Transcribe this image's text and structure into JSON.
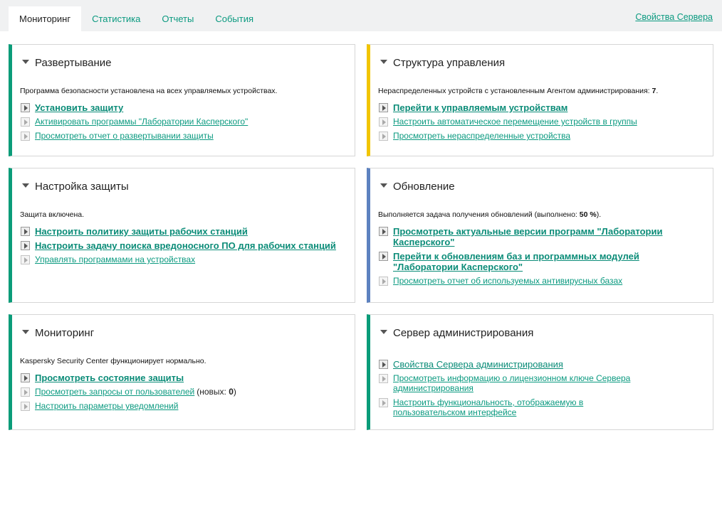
{
  "tabs": [
    {
      "label": "Мониторинг",
      "active": true
    },
    {
      "label": "Статистика",
      "active": false
    },
    {
      "label": "Отчеты",
      "active": false
    },
    {
      "label": "События",
      "active": false
    }
  ],
  "server_properties_link": "Свойства Сервера",
  "cards": {
    "deployment": {
      "title": "Развертывание",
      "desc": "Программа безопасности установлена на всех управляемых устройствах.",
      "links": [
        "Установить защиту",
        "Активировать программы \"Лаборатории Касперского\"",
        "Просмотреть отчет о развертывании защиты"
      ]
    },
    "structure": {
      "title": "Структура управления",
      "desc_prefix": "Нераспределенных устройств с установленным Агентом администрирования: ",
      "desc_value": "7",
      "desc_suffix": ".",
      "links": [
        "Перейти к управляемым устройствам",
        "Настроить автоматическое перемещение устройств в группы",
        "Просмотреть нераспределенные устройства"
      ]
    },
    "protection": {
      "title": "Настройка защиты",
      "desc": "Защита включена.",
      "links": [
        "Настроить политику защиты рабочих станций",
        "Настроить задачу поиска вредоносного ПО для рабочих станций",
        "Управлять программами на устройствах"
      ]
    },
    "update": {
      "title": "Обновление",
      "desc_prefix": "Выполняется задача получения обновлений (выполнено: ",
      "desc_value": "50 %",
      "desc_suffix": ").",
      "links": [
        "Просмотреть актуальные версии программ \"Лаборатории Касперского\"",
        "Перейти к обновлениям баз и программных модулей \"Лаборатории Касперского\"",
        "Просмотреть отчет об используемых антивирусных базах"
      ]
    },
    "monitoring": {
      "title": "Мониторинг",
      "desc": "Kaspersky Security Center функционирует нормально.",
      "links": [
        "Просмотреть состояние защиты",
        "Просмотреть запросы от пользователей",
        "Настроить параметры уведомлений"
      ],
      "requests_suffix_prefix": "(новых: ",
      "requests_suffix_value": "0",
      "requests_suffix_end": ")"
    },
    "admin_server": {
      "title": "Сервер администрирования",
      "links": [
        "Свойства Сервера администрирования",
        "Просмотреть информацию о лицензионном ключе Сервера администрирования",
        "Настроить функциональность, отображаемую в пользовательском интерфейсе"
      ]
    }
  },
  "colors": {
    "accent_green": "#0a9c79",
    "accent_yellow": "#f2c500",
    "accent_blue": "#5d82c0",
    "link": "#0b9a80"
  }
}
